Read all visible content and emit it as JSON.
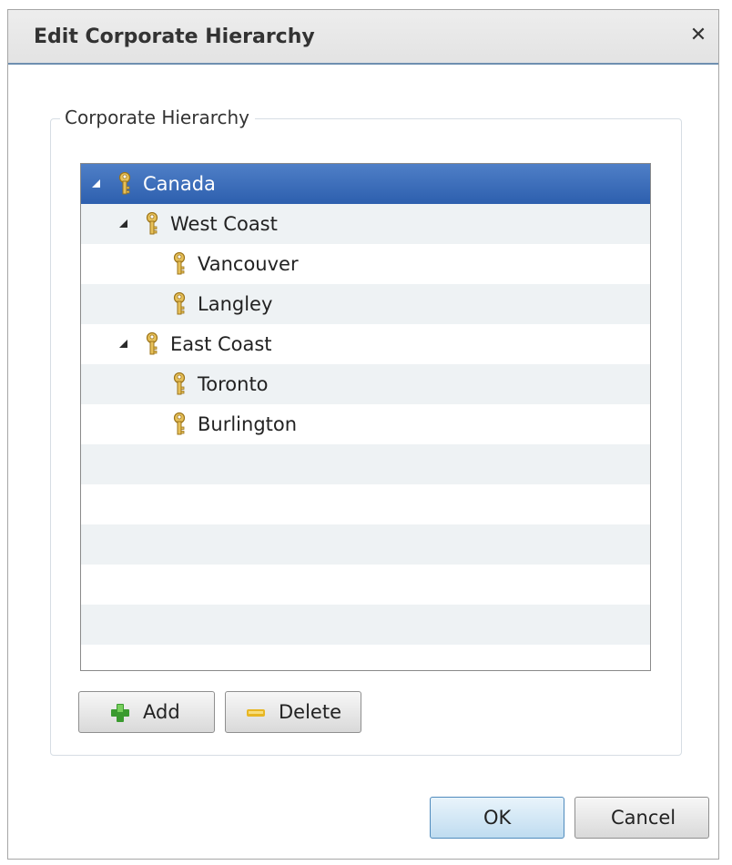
{
  "dialog": {
    "title": "Edit Corporate Hierarchy",
    "close_glyph": "✕",
    "close_icon": "close-icon"
  },
  "group": {
    "label": "Corporate Hierarchy"
  },
  "tree": {
    "icon": "key-icon",
    "expand_icon": "expanded-triangle-icon",
    "items": [
      {
        "label": "Canada",
        "level": 0,
        "expanded": true,
        "selected": true
      },
      {
        "label": "West Coast",
        "level": 1,
        "expanded": true,
        "selected": false
      },
      {
        "label": "Vancouver",
        "level": 2,
        "expanded": false,
        "selected": false
      },
      {
        "label": "Langley",
        "level": 2,
        "expanded": false,
        "selected": false
      },
      {
        "label": "East Coast",
        "level": 1,
        "expanded": true,
        "selected": false
      },
      {
        "label": "Toronto",
        "level": 2,
        "expanded": false,
        "selected": false
      },
      {
        "label": "Burlington",
        "level": 2,
        "expanded": false,
        "selected": false
      }
    ]
  },
  "buttons": {
    "add_label": "Add",
    "add_icon": "plus-icon",
    "delete_label": "Delete",
    "delete_icon": "minus-icon",
    "ok_label": "OK",
    "cancel_label": "Cancel"
  },
  "colors": {
    "selection": "#2d5fae",
    "title_accent": "#6e8fb0",
    "add_icon": "#3a9a2f",
    "delete_icon": "#e8b623",
    "key_icon": "#d6a72a"
  }
}
